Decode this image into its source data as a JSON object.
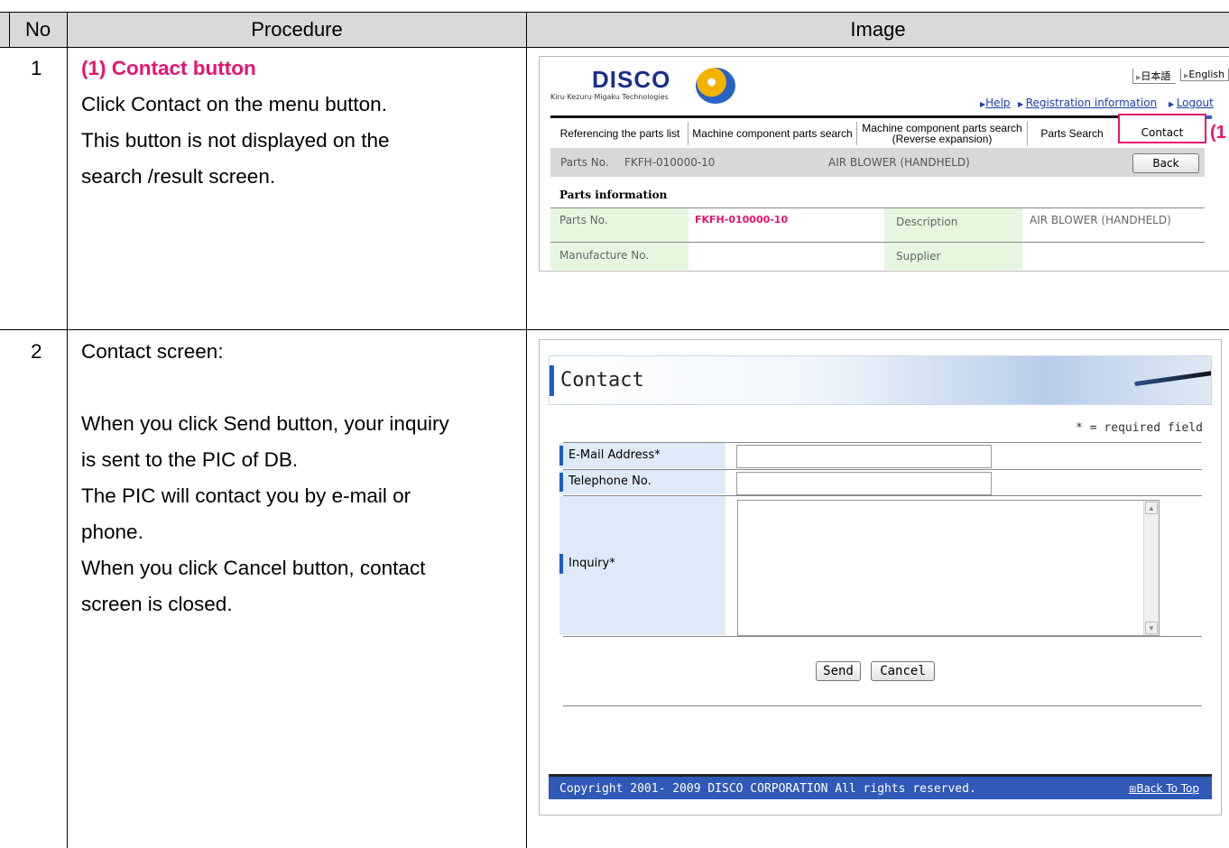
{
  "table": {
    "headers": {
      "no": "No",
      "procedure": "Procedure",
      "image": "Image"
    },
    "rows": [
      {
        "no": "1",
        "title": "(1) Contact button",
        "lines": [
          "Click Contact on the menu button.",
          "This button is not displayed on the",
          "search /result screen."
        ]
      },
      {
        "no": "2",
        "title": "Contact screen:",
        "lines": [
          "When you click Send button, your inquiry",
          "is sent to the PIC of DB.",
          "The PIC will contact you by e-mail or",
          "phone.",
          "When you click Cancel button, contact",
          "screen is closed."
        ]
      }
    ]
  },
  "shot1": {
    "logo": "DISCO",
    "tagline": "Kiru·Kezuru·Migaku Technologies",
    "lang_jp": "日本語",
    "lang_en": "English",
    "links": {
      "help": "Help",
      "registration": "Registration information",
      "logout": "Logout"
    },
    "tabs": {
      "parts_list": "Referencing the parts list",
      "component_search": "Machine component parts search",
      "reverse_line1": "Machine component parts search",
      "reverse_line2": "(Reverse expansion)",
      "parts_search": "Parts Search",
      "contact": "Contact"
    },
    "callout": "(1",
    "partsbar": {
      "label": "Parts No.",
      "value": "FKFH-010000-10",
      "description": "AIR BLOWER (HANDHELD)",
      "back": "Back"
    },
    "section_title": "Parts information",
    "info": {
      "parts_no_label": "Parts No.",
      "parts_no_value": "FKFH-010000-10",
      "description_label": "Description",
      "description_value": "AIR BLOWER (HANDHELD)",
      "manufacture_label": "Manufacture No.",
      "supplier_label": "Supplier"
    },
    "colors": {
      "accent": "#e6146e",
      "tab_active": "#2a63c6"
    }
  },
  "shot2": {
    "title": "Contact",
    "required_note": "* = required field",
    "fields": {
      "email": "E-Mail Address*",
      "telephone": "Telephone No.",
      "inquiry": "Inquiry*"
    },
    "buttons": {
      "send": "Send",
      "cancel": "Cancel"
    },
    "footer": {
      "copyright": "Copyright 2001- 2009 DISCO CORPORATION All rights reserved.",
      "back_to_top": "Back To Top"
    },
    "colors": {
      "footer_bg": "#2f58b7",
      "label_bg": "#deeaf8"
    }
  }
}
